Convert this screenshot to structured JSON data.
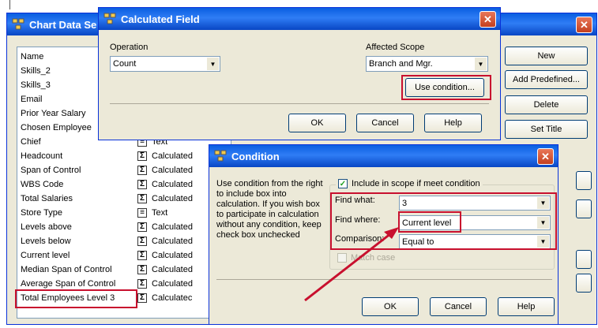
{
  "chart_data_settings": {
    "title": "Chart Data Se",
    "column_name": "Name",
    "rows": [
      {
        "name": "Skills_2",
        "type": ""
      },
      {
        "name": "Skills_3",
        "type": ""
      },
      {
        "name": "Email",
        "type": ""
      },
      {
        "name": "Prior Year Salary",
        "type": ""
      },
      {
        "name": "Chosen Employee",
        "type": ""
      },
      {
        "name": "Chief",
        "type": "Text"
      },
      {
        "name": "Headcount",
        "type": "Calculated"
      },
      {
        "name": "Span of Control",
        "type": "Calculated"
      },
      {
        "name": "WBS Code",
        "type": "Calculated"
      },
      {
        "name": "Total Salaries",
        "type": "Calculated"
      },
      {
        "name": "Store Type",
        "type": "Text"
      },
      {
        "name": "Levels above",
        "type": "Calculated"
      },
      {
        "name": "Levels below",
        "type": "Calculated"
      },
      {
        "name": "Current level",
        "type": "Calculated"
      },
      {
        "name": "Median Span of Control",
        "type": "Calculated"
      },
      {
        "name": "Average Span of Control",
        "type": "Calculated"
      },
      {
        "name": "Total Employees Level 3",
        "type": "Calculatec"
      }
    ],
    "buttons": {
      "new": "New",
      "add_predefined": "Add Predefined...",
      "delete": "Delete",
      "set_title": "Set Title"
    }
  },
  "calculated_field": {
    "title": "Calculated Field",
    "operation_label": "Operation",
    "operation_value": "Count",
    "scope_label": "Affected Scope",
    "scope_value": "Branch and Mgr.",
    "use_condition": "Use condition...",
    "ok": "OK",
    "cancel": "Cancel",
    "help": "Help"
  },
  "condition": {
    "title": "Condition",
    "description": "Use condition from the right to include box into calculation. If you wish box to participate in calculation without any condition, keep check box unchecked",
    "include_label": "Include in scope if meet condition",
    "include_checked": true,
    "find_what_label": "Find what:",
    "find_what_value": "3",
    "find_where_label": "Find where:",
    "find_where_value": "Current level",
    "comparison_label": "Comparison:",
    "comparison_value": "Equal to",
    "match_case_label": "Match case",
    "ok": "OK",
    "cancel": "Cancel",
    "help": "Help"
  },
  "colors": {
    "highlight": "#c8102e",
    "title_bar": "#0a5ee0",
    "dialog_bg": "#ece9d8"
  }
}
